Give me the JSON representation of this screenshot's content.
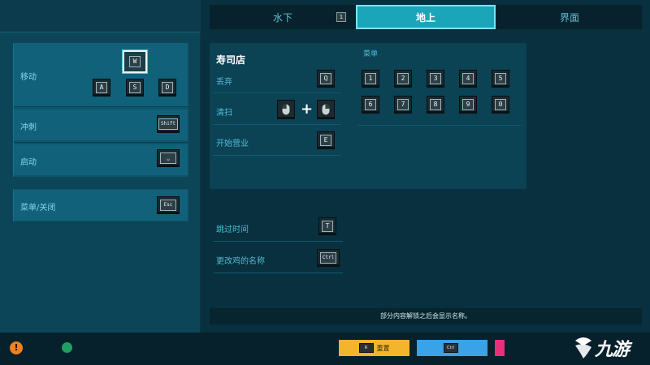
{
  "tabs": [
    {
      "label": "水下",
      "hint": "1"
    },
    {
      "label": "地上",
      "hint": ""
    },
    {
      "label": "界面",
      "hint": ""
    }
  ],
  "left": {
    "move_label": "移动",
    "move_keys": {
      "up": "W",
      "left": "A",
      "down": "S",
      "right": "D"
    },
    "dash_label": "冲刺",
    "dash_key": "Shift",
    "start_label": "启动",
    "start_key": "␣",
    "menu_label": "菜单/关闭",
    "menu_key": "Esc"
  },
  "sushi": {
    "title": "寿司店",
    "rows": [
      {
        "label": "丢弃",
        "key": "Q"
      },
      {
        "label": "清扫",
        "key": "mouse+mouse"
      },
      {
        "label": "开始营业",
        "key": "E"
      }
    ],
    "menu_label": "菜单",
    "menu_keys": [
      "1",
      "2",
      "3",
      "4",
      "5",
      "6",
      "7",
      "8",
      "9",
      "0"
    ]
  },
  "extra_rows": [
    {
      "label": "跳过时间",
      "key": "T"
    },
    {
      "label": "更改鸡的名称",
      "key": "Ctrl"
    }
  ],
  "notice": "部分内容解锁之后会显示名称。",
  "bottom": {
    "reset_label": "重置",
    "reset_key": "R",
    "ctrl_key": "Ctrl"
  },
  "watermark": "九游",
  "colors": {
    "accent": "#1aa5b9",
    "reset": "#f2b52c",
    "ctrl": "#3aa2e6",
    "warn": "#f08020"
  }
}
